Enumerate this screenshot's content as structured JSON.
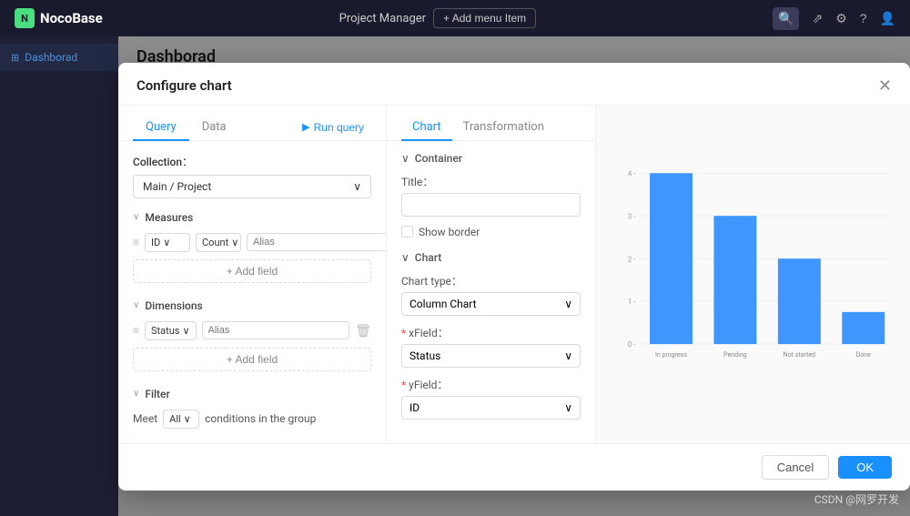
{
  "topNav": {
    "logoText": "NocoBase",
    "navTitle": "Project Manager",
    "addMenuLabel": "+ Add menu Item",
    "icons": [
      "search",
      "share",
      "settings",
      "help",
      "user"
    ]
  },
  "sidebar": {
    "items": [
      {
        "label": "Dashborad",
        "icon": "⊞",
        "active": true
      }
    ]
  },
  "mainHeader": {
    "title": "Dashborad"
  },
  "modal": {
    "title": "Configure chart",
    "queryPanel": {
      "tabs": [
        "Query",
        "Data"
      ],
      "runQueryLabel": "Run query",
      "collectionLabel": "Collection：",
      "collectionValue": "Main  /  Project",
      "measures": {
        "label": "Measures",
        "rows": [
          {
            "field": "ID",
            "aggregation": "Count",
            "alias": "Alias"
          }
        ],
        "addFieldLabel": "+ Add field"
      },
      "dimensions": {
        "label": "Dimensions",
        "rows": [
          {
            "field": "Status",
            "alias": "Alias"
          }
        ],
        "addFieldLabel": "+ Add field"
      },
      "filter": {
        "label": "Filter",
        "meetLabel": "Meet",
        "allLabel": "All",
        "conditionsLabel": "conditions in the group"
      }
    },
    "chartConfig": {
      "tabs": [
        "Chart",
        "Transformation"
      ],
      "container": {
        "label": "Container",
        "titleLabel": "Title：",
        "showBorderLabel": "Show border"
      },
      "chart": {
        "label": "Chart",
        "chartTypeLabel": "Chart type：",
        "chartTypeValue": "Column Chart",
        "xFieldLabel": "xField：",
        "xFieldValue": "Status",
        "yFieldLabel": "yField：",
        "yFieldValue": "ID"
      }
    },
    "footer": {
      "cancelLabel": "Cancel",
      "okLabel": "OK"
    }
  },
  "chart": {
    "bars": [
      {
        "label": "In progress",
        "value": 4,
        "color": "#4096ff"
      },
      {
        "label": "Pending",
        "value": 3,
        "color": "#4096ff"
      },
      {
        "label": "Not started",
        "value": 2,
        "color": "#4096ff"
      },
      {
        "label": "Done",
        "value": 1,
        "color": "#4096ff"
      }
    ],
    "yMax": 4,
    "yTicks": [
      0,
      1,
      2,
      3,
      4
    ]
  },
  "watermark": "CSDN @网罗开发"
}
